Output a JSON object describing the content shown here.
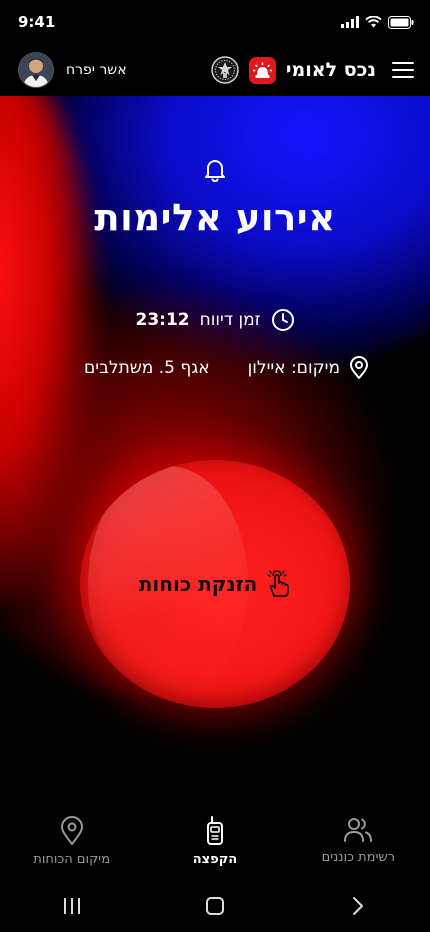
{
  "status_bar": {
    "time": "9:41"
  },
  "header": {
    "user_name": "אשר יפרח",
    "app_title": "נכס לאומי",
    "accent_color": "#e3171f"
  },
  "incident": {
    "title": "אירוע אלימות",
    "report_time_label": "זמן דיווח",
    "report_time": "23:12",
    "location_label": "מיקום: איילון",
    "location_detail": "אגף 5. משתלבים"
  },
  "dispatch_button": {
    "label": "הזנקת כוחות",
    "icon": "hand-pointer-icon"
  },
  "bottom_nav": {
    "items": [
      {
        "label": "רשימת כוננים",
        "icon": "users-icon",
        "active": false
      },
      {
        "label": "הקפצה",
        "icon": "walkie-talkie-icon",
        "active": true
      },
      {
        "label": "מיקום הכוחות",
        "icon": "map-pin-icon",
        "active": false
      }
    ]
  },
  "colors": {
    "alert_red": "#ff1a1a",
    "alert_blue": "#1515ff",
    "background": "#000000"
  }
}
